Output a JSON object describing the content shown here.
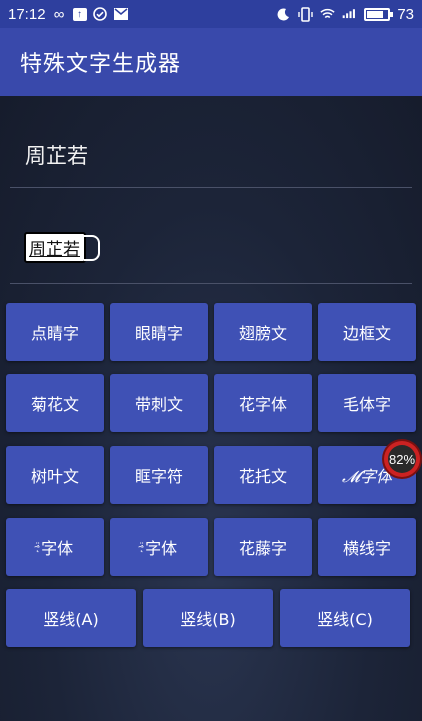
{
  "status_bar": {
    "time": "17:12",
    "battery": "73",
    "battery_level": 0.73
  },
  "app": {
    "title": "特殊文字生成器"
  },
  "input": {
    "value": "周芷若"
  },
  "output": {
    "value": "周芷若"
  },
  "buttons": {
    "row1": [
      "点睛字",
      "眼睛字",
      "翅膀文",
      "边框文"
    ],
    "row2": [
      "菊花文",
      "带刺文",
      "花字体",
      "毛体字"
    ],
    "row3": [
      "树叶文",
      "眶字符",
      "花托文",
      "𝓜字体"
    ],
    "row4": [
      "字体",
      "字体",
      "花藤字",
      "横线字"
    ],
    "row5": [
      "竖线(A)",
      "竖线(B)",
      "竖线(C)"
    ]
  },
  "overlay": {
    "percent": "82%"
  }
}
